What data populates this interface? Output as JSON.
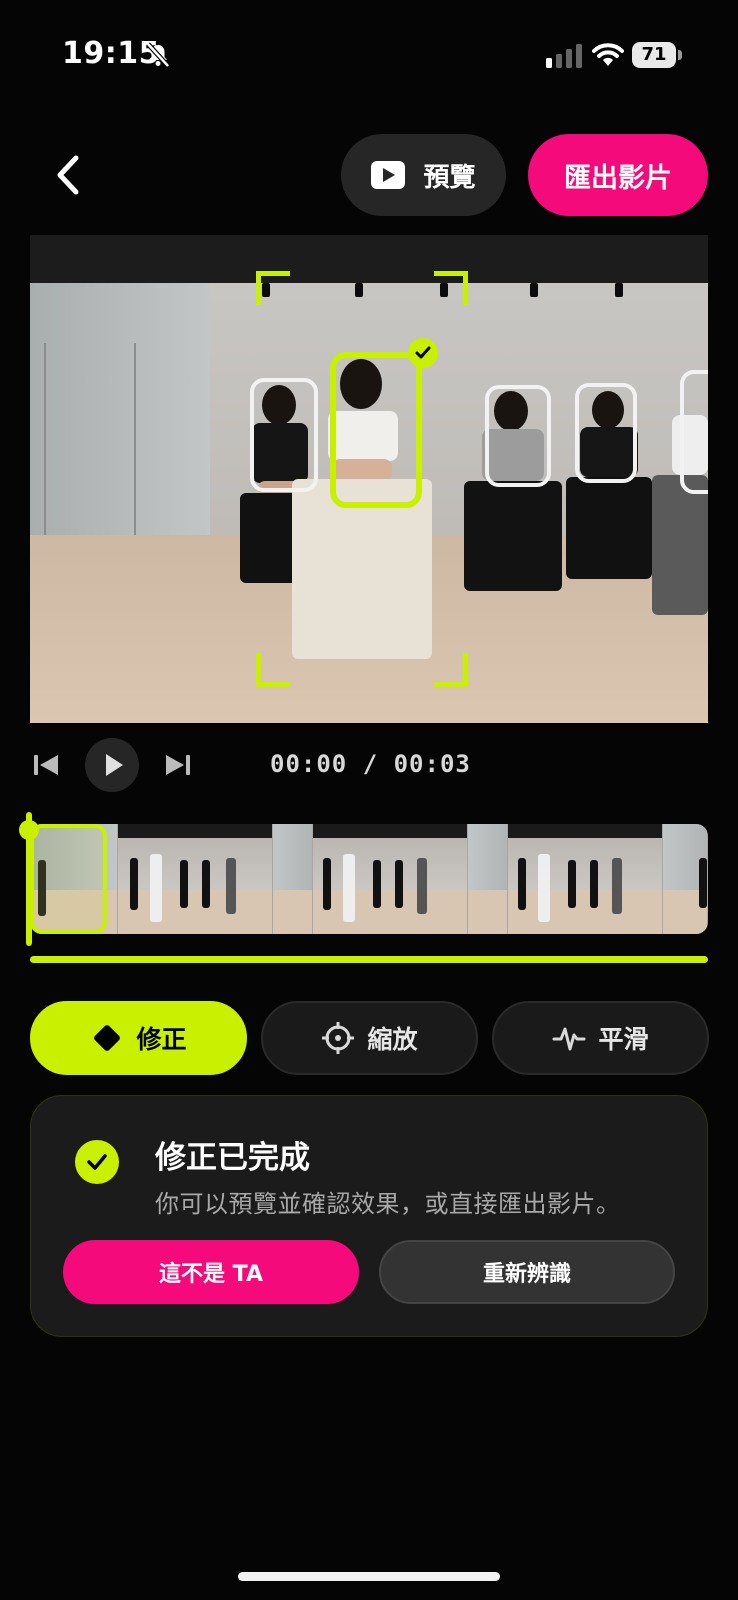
{
  "status_bar": {
    "time": "19:15",
    "battery": "71"
  },
  "header": {
    "preview_label": "預覽",
    "export_label": "匯出影片"
  },
  "player": {
    "timecode": "00:00 / 00:03"
  },
  "modes": [
    {
      "label": "修正",
      "active": true
    },
    {
      "label": "縮放",
      "active": false
    },
    {
      "label": "平滑",
      "active": false
    }
  ],
  "result_card": {
    "title": "修正已完成",
    "subtitle": "你可以預覽並確認效果，或直接匯出影片。",
    "not_ta_label": "這不是 TA",
    "redetect_label": "重新辨識"
  },
  "colors": {
    "accent": "#c9f000",
    "brand": "#f40a7a",
    "background": "#050505"
  }
}
